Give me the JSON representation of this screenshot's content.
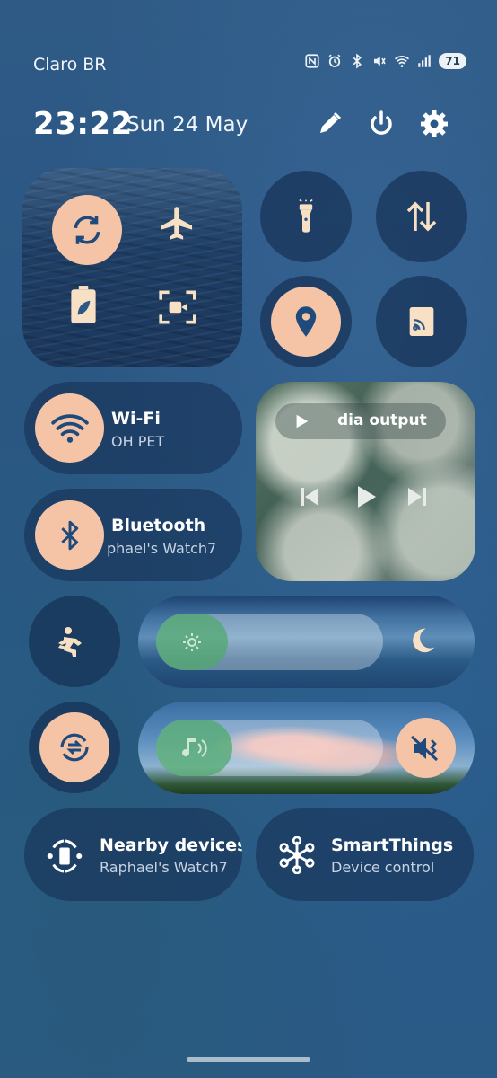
{
  "status": {
    "carrier": "Claro BR",
    "battery": "71",
    "icons": [
      "nfc-icon",
      "alarm-icon",
      "bluetooth-icon",
      "mute-icon",
      "wifi-icon",
      "signal-icon"
    ]
  },
  "header": {
    "time": "23:22",
    "date": "Sun 24 May",
    "icons": [
      "edit-icon",
      "power-icon",
      "settings-icon"
    ]
  },
  "quick_tiles": {
    "auto_rotate": "rotate-icon",
    "airplane": "airplane-icon",
    "power_saving": "battery-leaf-icon",
    "screen_recorder": "screen-record-icon",
    "flashlight": "flashlight-icon",
    "mobile_data": "data-transfer-icon",
    "location": "location-pin-icon",
    "cast": "cast-icon"
  },
  "wifi": {
    "label": "Wi-Fi",
    "sub": "OH PET"
  },
  "bluetooth": {
    "label": "Bluetooth",
    "sub": "phael's Watch7"
  },
  "media": {
    "output_label": "dia output"
  },
  "sliders": {
    "brightness_level": 0.25,
    "volume_level": 0.22
  },
  "nearby": {
    "label": "Nearby devices",
    "sub": "Raphael's Watch7"
  },
  "smartthings": {
    "label": "SmartThings",
    "sub": "Device control"
  },
  "colors": {
    "accent_on": "#f5c4a6",
    "icon_on": "#1f4a7c",
    "icon_off": "#f7e0c4",
    "slider_fill": "#50aa6e"
  }
}
